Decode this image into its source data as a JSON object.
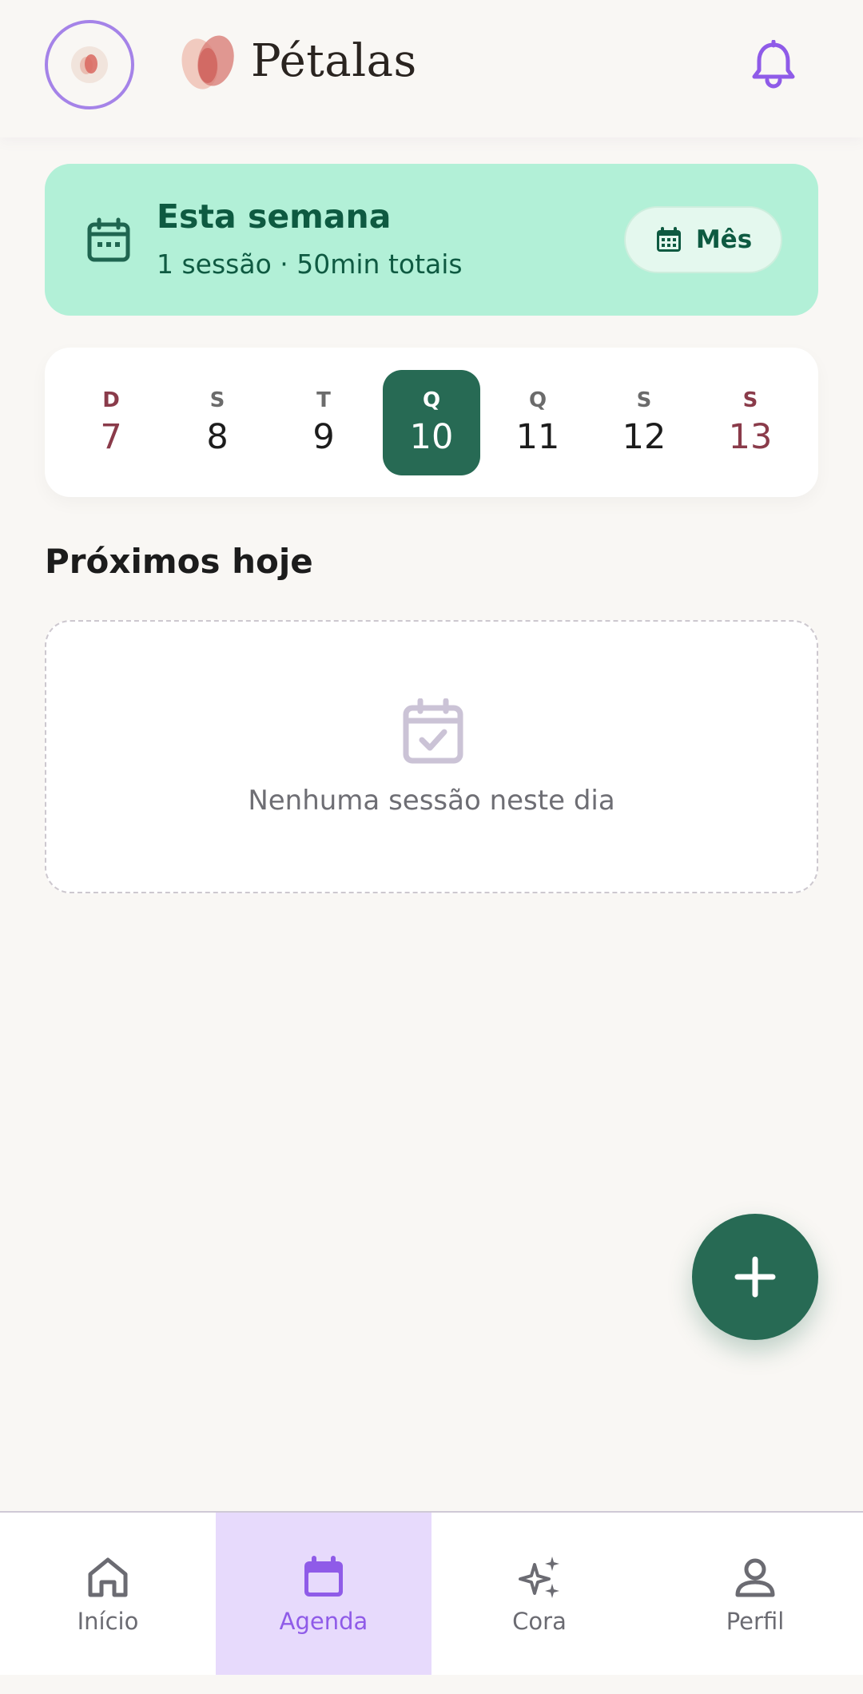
{
  "header": {
    "app_title": "Pétalas",
    "avatar_icon": "petal-logo-icon",
    "notifications_icon": "bell-icon"
  },
  "week_summary": {
    "title": "Esta semana",
    "subtitle": "1 sessão · 50min totais",
    "month_button_label": "Mês",
    "icon": "calendar-icon"
  },
  "days": [
    {
      "letter": "D",
      "number": "7",
      "weekend": true,
      "selected": false
    },
    {
      "letter": "S",
      "number": "8",
      "weekend": false,
      "selected": false
    },
    {
      "letter": "T",
      "number": "9",
      "weekend": false,
      "selected": false
    },
    {
      "letter": "Q",
      "number": "10",
      "weekend": false,
      "selected": true
    },
    {
      "letter": "Q",
      "number": "11",
      "weekend": false,
      "selected": false
    },
    {
      "letter": "S",
      "number": "12",
      "weekend": false,
      "selected": false
    },
    {
      "letter": "S",
      "number": "13",
      "weekend": true,
      "selected": false
    }
  ],
  "upcoming": {
    "title": "Próximos hoje",
    "empty_text": "Nenhuma sessão neste dia",
    "empty_icon": "calendar-check-icon"
  },
  "fab": {
    "icon": "plus-icon"
  },
  "nav": {
    "items": [
      {
        "label": "Início",
        "icon": "home-icon",
        "active": false
      },
      {
        "label": "Agenda",
        "icon": "calendar-icon",
        "active": true
      },
      {
        "label": "Cora",
        "icon": "sparkles-icon",
        "active": false
      },
      {
        "label": "Perfil",
        "icon": "person-icon",
        "active": false
      }
    ]
  },
  "colors": {
    "background": "#f9f7f4",
    "accent_green": "#276a54",
    "mint": "#b2f0d7",
    "purple": "#8f5be8",
    "weekend": "#8a3b4a"
  }
}
